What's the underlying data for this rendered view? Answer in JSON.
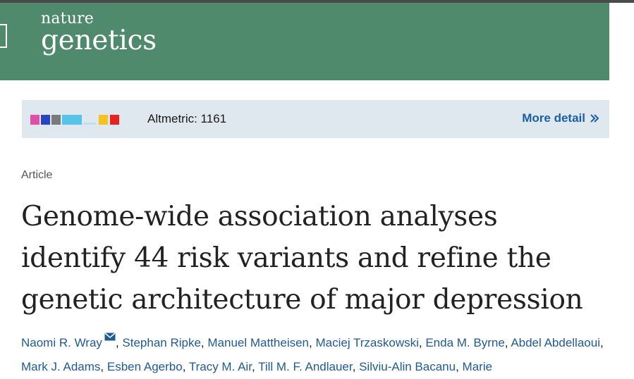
{
  "header": {
    "logo_line1": "nature",
    "logo_line2": "genetics",
    "background": "#4e8a6b"
  },
  "altmetric": {
    "score_text": "Altmetric: 1161",
    "more_label": "More detail",
    "more_icon": "double-chevron-right-icon",
    "donut_colors": [
      "#e04fa5",
      "#2744c7",
      "#7a7a7a",
      "#56c3ea",
      "#56c3ea",
      "#dfe8ee",
      "#f7c21d",
      "#e8231f"
    ]
  },
  "article": {
    "type": "Article",
    "title": "Genome-wide association analyses identify 44 risk variants and refine the genetic architecture of major depression"
  },
  "authors": {
    "corresponding_icon": "mail-icon",
    "list": [
      "Naomi R. Wray",
      "Stephan Ripke",
      "Manuel Mattheisen",
      "Maciej Trzaskowski",
      "Enda M. Byrne",
      "Abdel Abdellaoui",
      "Mark J. Adams",
      "Esben Agerbo",
      "Tracy M. Air",
      "Till M. F. Andlauer",
      "Silviu-Alin Bacanu",
      "Marie"
    ]
  }
}
